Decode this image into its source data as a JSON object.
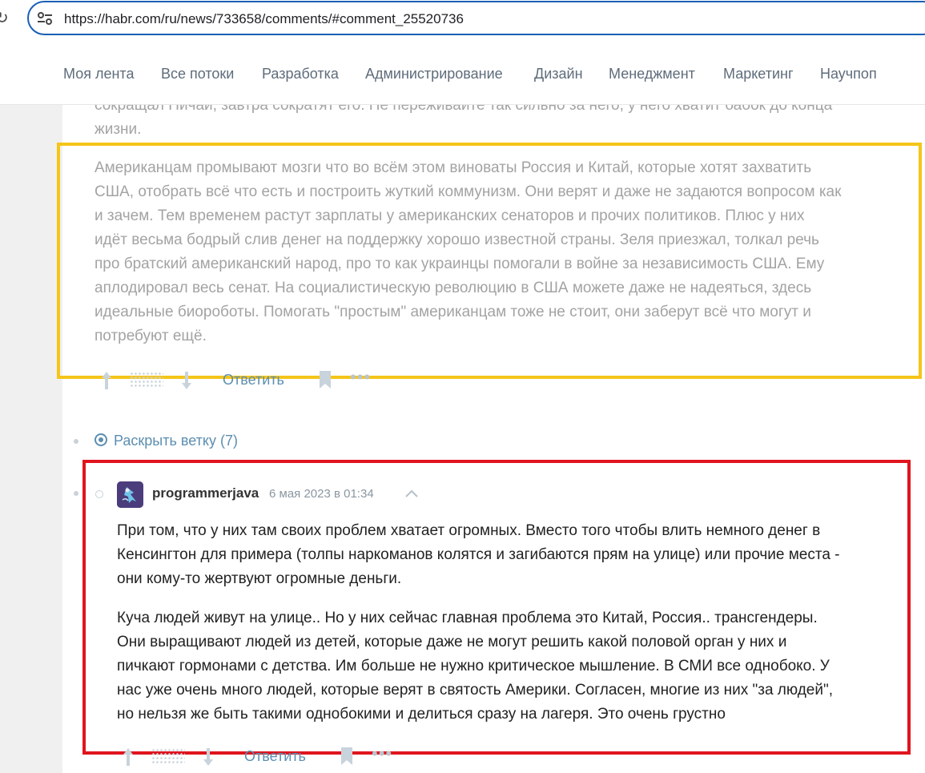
{
  "browser": {
    "url": "https://habr.com/ru/news/733658/comments/#comment_25520736"
  },
  "nav": {
    "items": [
      "Моя лента",
      "Все потоки",
      "Разработка",
      "Администрирование",
      "Дизайн",
      "Менеджмент",
      "Маркетинг",
      "Научпоп"
    ]
  },
  "prev_comment": {
    "partial_lines": [
      "сокращал Пичаи, завтра сократят его. Не переживайте так сильно за него, у него хватит бабок до конца",
      "жизни."
    ],
    "paragraph_lines": [
      "Американцам промывают мозги что во всём этом виноваты Россия и Китай, которые хотят захватить",
      "США, отобрать всё что есть и построить жуткий коммунизм. Они верят и даже не задаются вопросом как",
      "и зачем. Тем временем растут зарплаты у американских сенаторов и прочих политиков. Плюс у них",
      "идёт весьма бодрый слив денег на поддержку хорошо известной страны. Зеля приезжал, толкал речь",
      "про братский американский народ, про то как украинцы помогали в войне за независимость США. Ему",
      "аплодировал весь сенат. На социалистическую революцию в США можете даже не надеяться, здесь",
      "идеальные биороботы. Помогать \"простым\" американцам тоже не стоит, они заберут всё что могут и",
      "потребуют ещё."
    ],
    "reply_label": "Ответить"
  },
  "thread": {
    "expand_label": "Раскрыть ветку (7)"
  },
  "comment": {
    "author": "programmerjava",
    "date": "6 мая 2023 в 01:34",
    "paragraph1_lines": [
      "При том, что у них там своих проблем хватает огромных. Вместо того чтобы влить немного денег в",
      "Кенсингтон для примера (толпы наркоманов колятся и загибаются прям на улице) или прочие места -",
      "они кому-то жертвуют огромные деньги."
    ],
    "paragraph2_lines": [
      "Куча людей живут на улице.. Но у них сейчас главная проблема это Китай, Россия.. трансгендеры.",
      "Они выращивают людей из детей, которые даже не могут решить какой половой орган у них и",
      "пичкают гормонами с детства. Им больше не нужно критическое мышление. В СМИ все однобоко. У",
      "нас уже очень много людей, которые верят в святость Америки. Согласен, многие из них \"за людей\",",
      "но нельзя же быть такими однобокими и делиться сразу на лагеря. Это очень грустно"
    ],
    "reply_label": "Ответить"
  },
  "icons": {
    "reload": "reload-icon",
    "site_settings": "tune-icon",
    "upvote": "arrow-up-icon",
    "downvote": "arrow-down-icon",
    "bookmark": "bookmark-icon",
    "more": "more-icon",
    "expand": "expand-thread-icon",
    "collapse": "chevron-up-icon"
  },
  "colors": {
    "highlight_yellow": "#f5c518",
    "highlight_red": "#e0141f",
    "link": "#5c8eb0",
    "url_border": "#1a5fb4"
  }
}
